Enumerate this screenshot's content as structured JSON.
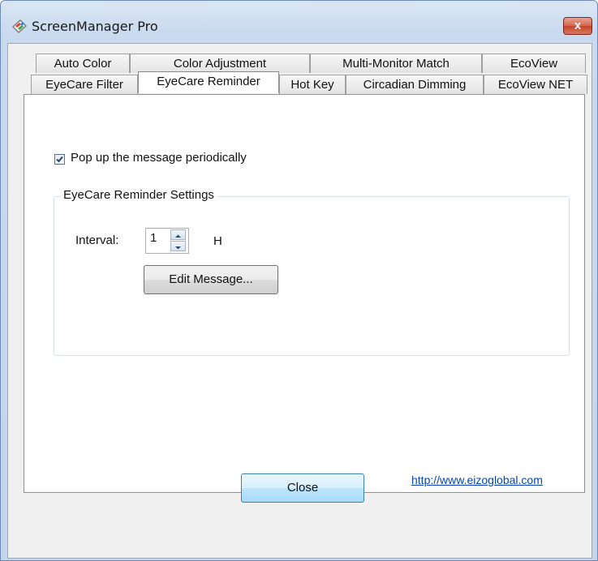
{
  "window": {
    "title": "ScreenManager Pro",
    "close_glyph": "x"
  },
  "tabs": {
    "row1": [
      "Auto Color",
      "Color Adjustment",
      "Multi-Monitor Match",
      "EcoView"
    ],
    "row2": [
      "EyeCare Filter",
      "EyeCare Reminder",
      "Hot Key",
      "Circadian Dimming",
      "EcoView NET"
    ],
    "active": "EyeCare Reminder"
  },
  "reminder": {
    "checkbox_label": "Pop up the message periodically",
    "checked": true,
    "group_title": "EyeCare Reminder Settings",
    "interval_label": "Interval:",
    "interval_value": "1",
    "interval_unit": "H",
    "edit_button": "Edit Message..."
  },
  "footer": {
    "link": "http://www.eizoglobal.com",
    "close_button": "Close"
  },
  "icons": {
    "app": "screenmanager-icon",
    "close": "close-icon",
    "check": "checkmark-icon",
    "up": "arrow-up-icon",
    "down": "arrow-down-icon"
  }
}
